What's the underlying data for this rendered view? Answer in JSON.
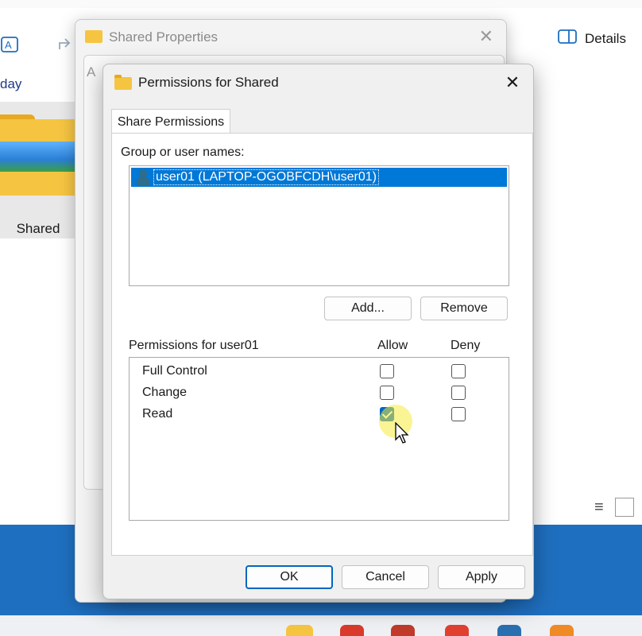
{
  "explorer": {
    "details_label": "Details",
    "day_label": "day",
    "folder_name": "Shared"
  },
  "properties_window": {
    "title": "Shared Properties",
    "close_glyph": "✕",
    "partial_label": "A"
  },
  "permissions_dialog": {
    "title": "Permissions for Shared",
    "close_glyph": "✕",
    "tab_label": "Share Permissions",
    "group_label": "Group or user names:",
    "users": [
      {
        "name": "user01 (LAPTOP-OGOBFCDH\\user01)",
        "selected": true,
        "icon": "user-icon"
      }
    ],
    "add_button": "Add...",
    "remove_button": "Remove",
    "permissions_label": "Permissions for user01",
    "allow_header": "Allow",
    "deny_header": "Deny",
    "permissions": [
      {
        "name": "Full Control",
        "allow": false,
        "deny": false
      },
      {
        "name": "Change",
        "allow": false,
        "deny": false
      },
      {
        "name": "Read",
        "allow": true,
        "deny": false
      }
    ],
    "ok_button": "OK",
    "cancel_button": "Cancel",
    "apply_button": "Apply"
  },
  "colors": {
    "selection": "#0078d7",
    "accent": "#0067c0",
    "folder": "#f5c542",
    "taskbar_blue": "#1f6fc0"
  }
}
